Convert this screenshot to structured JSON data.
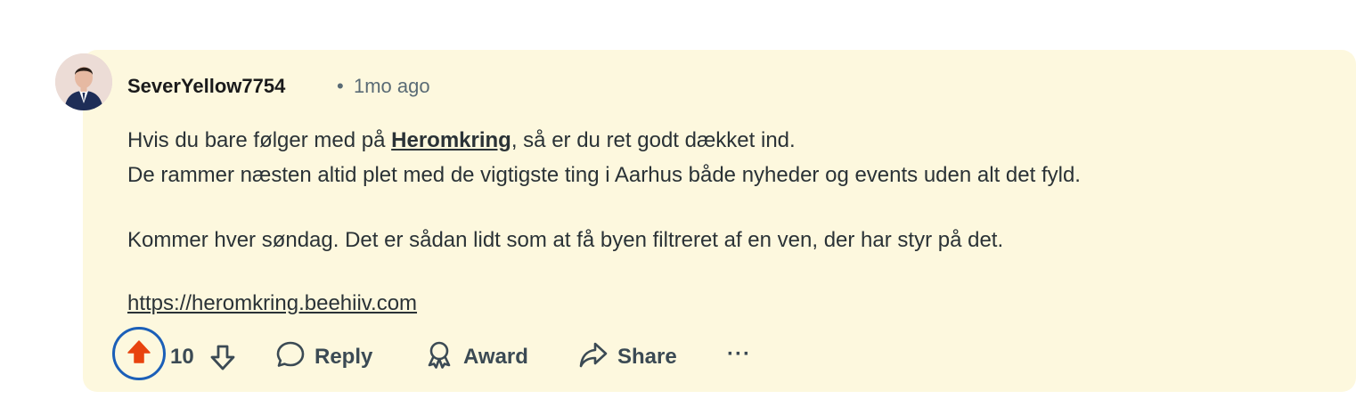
{
  "comment": {
    "author": "SeverYellow7754",
    "separator": "•",
    "timestamp": "1mo ago",
    "lines": {
      "line1_pre": "Hvis du bare følger med på ",
      "line1_link": "Heromkring",
      "line1_post": ", så er du ret godt dækket ind.",
      "line2": "De rammer næsten altid plet med de vigtigste ting i Aarhus både nyheder og events uden alt det fyld.",
      "line3": "Kommer hver søndag. Det er sådan lidt som at få byen filtreret af en ven, der har styr på det.",
      "line4_url": "https://heromkring.beehiiv.com"
    }
  },
  "actions": {
    "vote_count": "10",
    "reply_label": "Reply",
    "award_label": "Award",
    "share_label": "Share",
    "more_label": "···"
  },
  "colors": {
    "card_bg": "#fdf8de",
    "upvote_active": "#e8430e",
    "focus_ring": "#1b5fb8",
    "text": "#2a3236",
    "muted": "#5a6b75"
  },
  "icons": {
    "avatar": "user-avatar",
    "upvote": "upvote-arrow-icon",
    "downvote": "downvote-arrow-icon",
    "reply": "speech-bubble-icon",
    "award": "award-ribbon-icon",
    "share": "share-arrow-icon",
    "more": "more-dots-icon"
  }
}
